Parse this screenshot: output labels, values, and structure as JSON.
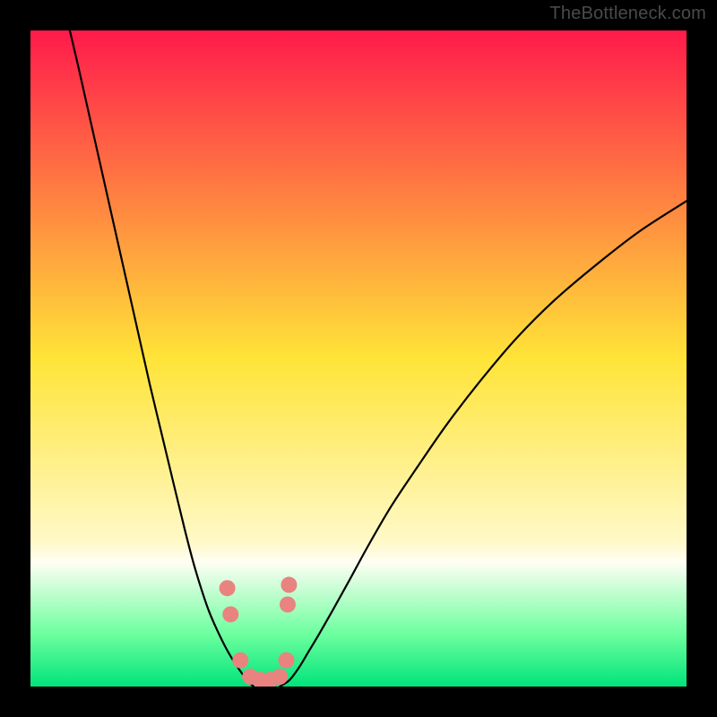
{
  "watermark": "TheBottleneck.com",
  "chart_data": {
    "type": "line",
    "title": "",
    "xlabel": "",
    "ylabel": "",
    "xlim": [
      0,
      100
    ],
    "ylim": [
      0,
      100
    ],
    "grid": false,
    "legend": false,
    "background_gradient": {
      "stops": [
        {
          "pos": 0.0,
          "color": "#ff1a4b"
        },
        {
          "pos": 0.5,
          "color": "#ffe438"
        },
        {
          "pos": 0.78,
          "color": "#fff9c8"
        },
        {
          "pos": 0.81,
          "color": "#fffef4"
        },
        {
          "pos": 0.92,
          "color": "#6dff9f"
        },
        {
          "pos": 1.0,
          "color": "#00e47a"
        }
      ]
    },
    "series": [
      {
        "name": "left-branch",
        "x": [
          6.0,
          7.4,
          9.2,
          11.0,
          12.8,
          14.6,
          16.4,
          18.2,
          20.0,
          21.8,
          23.5,
          24.8,
          26.0,
          27.2,
          28.5,
          30.0,
          31.4,
          33.0,
          34.0
        ],
        "y": [
          100.0,
          94.0,
          86.0,
          78.0,
          70.0,
          62.0,
          54.0,
          46.0,
          38.5,
          31.0,
          24.0,
          19.0,
          15.0,
          11.5,
          8.5,
          5.5,
          3.2,
          1.0,
          0.0
        ]
      },
      {
        "name": "right-branch",
        "x": [
          38.0,
          39.5,
          41.0,
          42.5,
          44.0,
          46.0,
          48.5,
          51.5,
          55.0,
          59.0,
          63.5,
          68.5,
          74.0,
          80.0,
          86.5,
          93.0,
          100.0
        ],
        "y": [
          0.0,
          1.0,
          3.0,
          5.5,
          8.0,
          11.5,
          16.0,
          21.5,
          27.5,
          33.5,
          40.0,
          46.5,
          53.0,
          59.0,
          64.5,
          69.5,
          74.0
        ]
      }
    ],
    "markers": {
      "name": "highlight-dots",
      "color": "#e98380",
      "points": [
        {
          "x": 30.0,
          "y": 15.0
        },
        {
          "x": 30.5,
          "y": 11.0
        },
        {
          "x": 32.0,
          "y": 4.0
        },
        {
          "x": 33.5,
          "y": 1.5
        },
        {
          "x": 35.0,
          "y": 1.0
        },
        {
          "x": 36.5,
          "y": 1.0
        },
        {
          "x": 38.0,
          "y": 1.5
        },
        {
          "x": 39.0,
          "y": 4.0
        },
        {
          "x": 39.2,
          "y": 12.5
        },
        {
          "x": 39.4,
          "y": 15.5
        }
      ]
    },
    "annotations": []
  }
}
